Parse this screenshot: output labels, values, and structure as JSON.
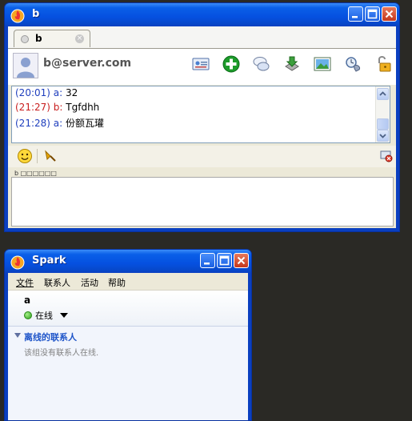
{
  "chat_window": {
    "title": "b",
    "tab_label": "b",
    "contact_name": "b@server.com",
    "toolbar_icons": [
      "vcard-icon",
      "add-contact-icon",
      "chat-history-icon",
      "file-transfer-icon",
      "screenshot-icon",
      "call-icon",
      "unlock-icon"
    ],
    "messages": [
      {
        "time": "(20:01)",
        "sender": "a:",
        "text": "32",
        "color": "blue"
      },
      {
        "time": "(21:27)",
        "sender": "b:",
        "text": "Tgfdhh",
        "color": "red"
      },
      {
        "time": "(21:28)",
        "sender": "a:",
        "text": "份额瓦瓘",
        "color": "blue"
      }
    ],
    "typing_status": "b □□□□□□",
    "input_value": ""
  },
  "spark_window": {
    "title": "Spark",
    "menu": [
      "文件",
      "联系人",
      "活动",
      "帮助"
    ],
    "user_name": "a",
    "status": "在线",
    "group_name": "离线的联系人",
    "group_note": "该组没有联系人在线."
  },
  "colors": {
    "title_bar": "#0a5fe8",
    "sender_a": "#1e3ebd",
    "sender_b": "#c81e1e",
    "group_header": "#1f55c9"
  }
}
